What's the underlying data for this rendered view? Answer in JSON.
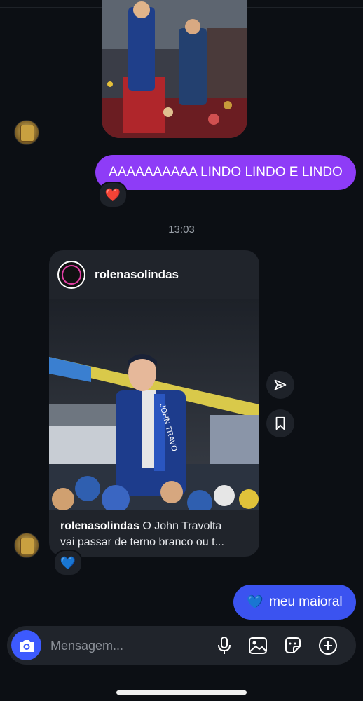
{
  "messages": {
    "outgoing_1": "AAAAAAAAAA LINDO LINDO E LINDO",
    "outgoing_1_reaction": "❤️",
    "timestamp": "13:03",
    "outgoing_2_emoji": "💙",
    "outgoing_2_text": "meu maioral"
  },
  "shared_post": {
    "username": "rolenasolindas",
    "caption_user": "rolenasolindas",
    "caption_line1": " O John Travolta",
    "caption_line2": "vai passar de terno branco ou t...",
    "reaction": "💙",
    "figure_sash_text": "JOHN TRAVO"
  },
  "composer": {
    "placeholder": "Mensagem..."
  },
  "icons": [
    "camera-icon",
    "mic-icon",
    "gallery-icon",
    "sticker-icon",
    "plus-icon",
    "send-icon",
    "bookmark-icon"
  ],
  "colors": {
    "background": "#0c0f14",
    "outgoing_purple": "#8e3cf7",
    "outgoing_blue": "#3b53f0",
    "camera_blue": "#3d5afe"
  }
}
